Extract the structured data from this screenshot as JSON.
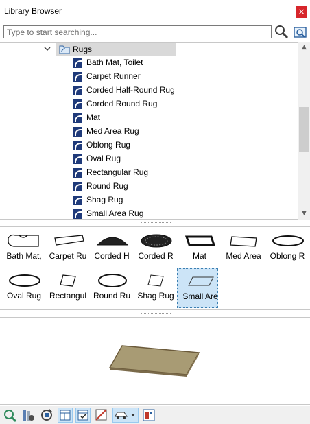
{
  "window": {
    "title": "Library Browser",
    "close_label": "×"
  },
  "search": {
    "placeholder": "Type to start searching...",
    "value": ""
  },
  "icons": {
    "search": "magnifier-icon",
    "search_in_folder": "folder-search-icon",
    "folder": "folder-icon",
    "item": "rug-object-icon"
  },
  "tree": {
    "folder": {
      "label": "Rugs",
      "expanded": true
    },
    "items": [
      "Bath Mat, Toilet",
      "Carpet Runner",
      "Corded Half-Round Rug",
      "Corded Round Rug",
      "Mat",
      "Med Area Rug",
      "Oblong Rug",
      "Oval Rug",
      "Rectangular Rug",
      "Round Rug",
      "Shag Rug",
      "Small Area Rug"
    ]
  },
  "thumbnails": [
    {
      "label": "Bath Mat,",
      "shape": "bathmat"
    },
    {
      "label": "Carpet Ru",
      "shape": "runner"
    },
    {
      "label": "Corded H",
      "shape": "corded-half"
    },
    {
      "label": "Corded R",
      "shape": "corded-round"
    },
    {
      "label": "Mat",
      "shape": "mat"
    },
    {
      "label": "Med Area",
      "shape": "rect"
    },
    {
      "label": "Oblong R",
      "shape": "oblong"
    },
    {
      "label": "Oval Rug",
      "shape": "oval"
    },
    {
      "label": "Rectangul",
      "shape": "rect-small"
    },
    {
      "label": "Round Ru",
      "shape": "round"
    },
    {
      "label": "Shag Rug",
      "shape": "shag"
    },
    {
      "label": "Small Are",
      "shape": "small-area",
      "selected": true
    }
  ],
  "preview": {
    "object_color": "#a89b74"
  },
  "colors": {
    "accent": "#cce4f7",
    "close": "#d7262b",
    "tree_icon": "#1f3a7a"
  },
  "bottom_toolbar": [
    "refresh-search-icon",
    "library-settings-icon",
    "sync-icon",
    "view-list-icon",
    "view-check-icon",
    "view-3d-icon",
    "car-dropdown-icon",
    "properties-icon"
  ]
}
